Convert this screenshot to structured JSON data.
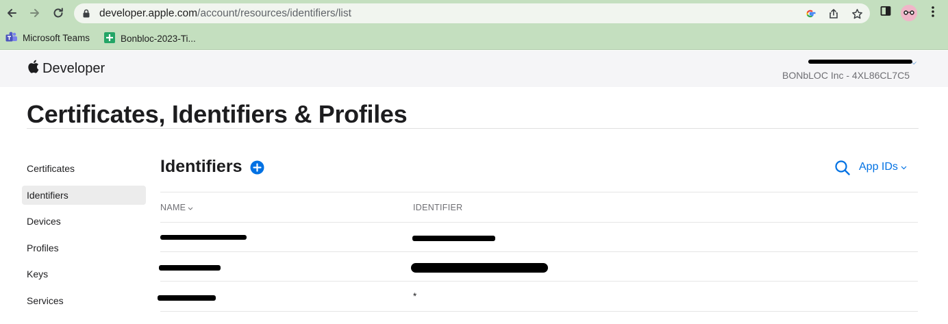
{
  "browser": {
    "url_host": "developer.apple.com",
    "url_path": "/account/resources/identifiers/list",
    "bookmarks": [
      {
        "label": "Microsoft Teams",
        "icon": "teams-icon"
      },
      {
        "label": "Bonbloc-2023-Ti...",
        "icon": "sheets-icon"
      }
    ]
  },
  "header": {
    "logo_text": "Developer",
    "account_name": "",
    "team": "BONbLOC Inc - 4XL86CL7C5"
  },
  "page": {
    "title": "Certificates, Identifiers & Profiles"
  },
  "sidebar": {
    "items": [
      {
        "label": "Certificates",
        "active": false
      },
      {
        "label": "Identifiers",
        "active": true
      },
      {
        "label": "Devices",
        "active": false
      },
      {
        "label": "Profiles",
        "active": false
      },
      {
        "label": "Keys",
        "active": false
      },
      {
        "label": "Services",
        "active": false
      }
    ]
  },
  "main": {
    "section_title": "Identifiers",
    "filter_label": "App IDs",
    "columns": {
      "name": "NAME",
      "identifier": "IDENTIFIER"
    },
    "rows": [
      {
        "name": "",
        "identifier": ""
      },
      {
        "name": "",
        "identifier": ""
      },
      {
        "name": "",
        "identifier": "*"
      }
    ]
  },
  "colors": {
    "browser_chrome": "#c4dfbf",
    "accent": "#0071e3",
    "header_bg": "#f5f5f7"
  }
}
